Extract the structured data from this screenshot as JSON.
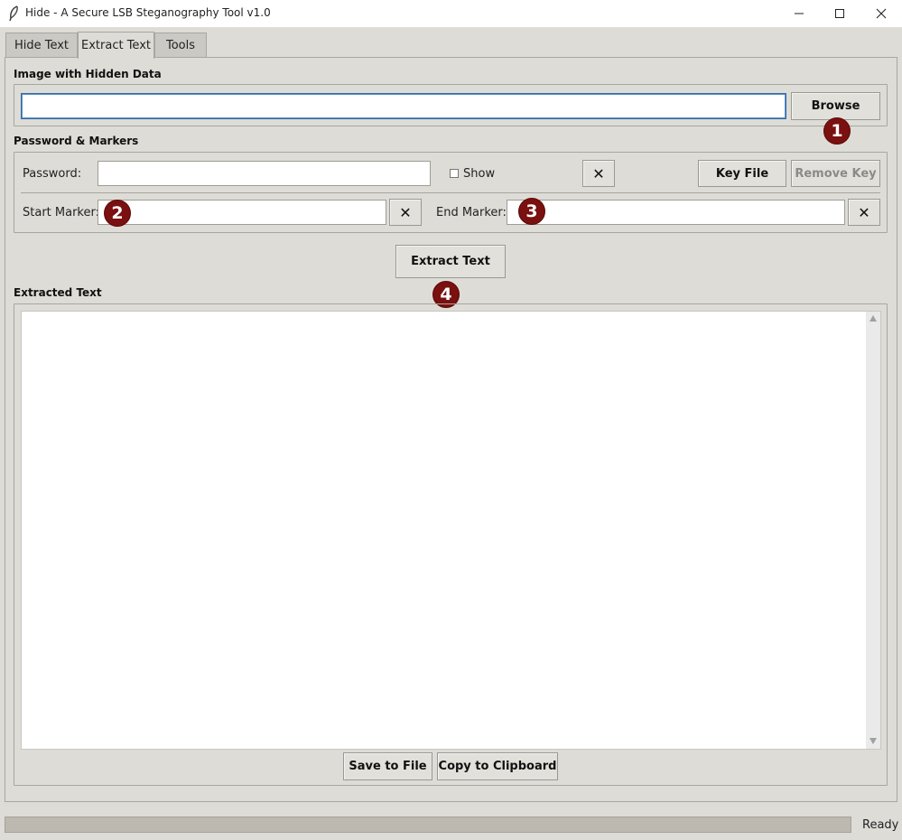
{
  "window": {
    "title": "Hide - A Secure LSB Steganography Tool v1.0",
    "icon": "feather-icon",
    "controls": [
      "minimize-icon",
      "maximize-icon",
      "close-icon"
    ]
  },
  "tabs": [
    {
      "label": "Hide Text",
      "active": false
    },
    {
      "label": "Extract Text",
      "active": true
    },
    {
      "label": "Tools",
      "active": false
    }
  ],
  "image_section": {
    "label": "Image with Hidden Data",
    "path_value": "",
    "browse_label": "Browse"
  },
  "password_section": {
    "label": "Password & Markers",
    "password_label": "Password:",
    "password_value": "",
    "show_label": "Show",
    "show_checked": false,
    "clear_symbol": "✕",
    "key_file_label": "Key File",
    "remove_key_label": "Remove Key",
    "start_marker_label": "Start Marker:",
    "start_marker_value": "",
    "end_marker_label": "End Marker:",
    "end_marker_value": ""
  },
  "extract_button_label": "Extract Text",
  "output_section": {
    "label": "Extracted Text",
    "text_value": "",
    "save_label": "Save to File",
    "copy_label": "Copy to Clipboard"
  },
  "status": {
    "text": "Ready",
    "progress": 0
  },
  "annotations": {
    "badge_1": "1",
    "badge_2": "2",
    "badge_3": "3",
    "badge_4": "4",
    "badge_color": "#7a1010"
  }
}
